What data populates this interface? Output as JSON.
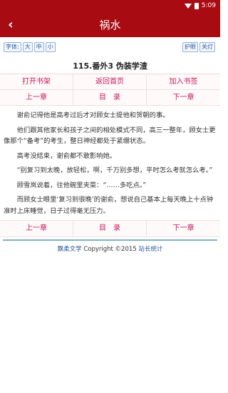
{
  "status_bar": {
    "time": "5:09"
  },
  "header": {
    "title": "祸水",
    "back_symbol": "‹"
  },
  "toolbar": {
    "font_label": "字体:",
    "font_sizes": [
      "大",
      "中",
      "小"
    ],
    "eye_care": "护眼",
    "light_off": "关灯"
  },
  "chapter": {
    "title": "115.番外3 伪装学渣"
  },
  "top_nav": {
    "open_bookshelf": "打开书架",
    "back_home": "返回首页",
    "add_bookmark": "加入书签",
    "prev_chapter": "上一章",
    "toc": "目　录",
    "next_chapter": "下一章"
  },
  "content": {
    "paragraphs": [
      "谢俞记得他是高考过后才对顾女士提他和贺朝的事。",
      "他们跟其他家长和孩子之间的相处模式不同，高三一整年，顾女士更像那个“备考”的考生，整日神经都处于紧绷状态。",
      "高考没结束，谢俞都不敢影响她。",
      "“别复习到太晚，放轻松，啊，千万别多想，平时怎么考就怎么考。”",
      "顾雪岚说着，往他碗里夹菜：“……多吃点。”",
      "而顾女士眼里‘复习到很晚’的谢俞，想说自己基本上每天晚上十点钟准时上床睡觉，日子过得毫无压力。"
    ]
  },
  "bottom_nav": {
    "prev_chapter": "上一章",
    "toc": "目　录",
    "next_chapter": "下一章"
  },
  "footer": {
    "site": "飘柔文学",
    "copyright": "Copyright ©2015",
    "stats": "站长统计"
  }
}
